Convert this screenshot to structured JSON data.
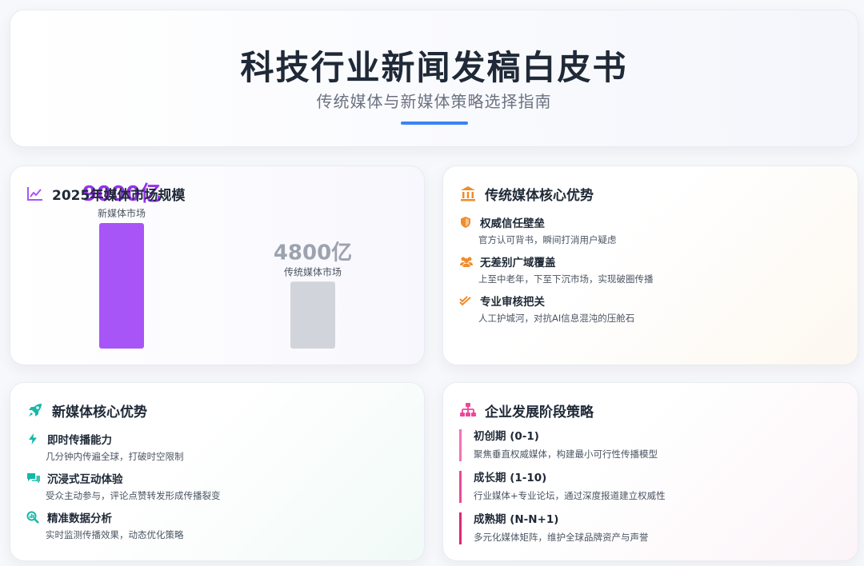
{
  "header": {
    "title": "科技行业新闻发稿白皮书",
    "subtitle": "传统媒体与新媒体策略选择指南"
  },
  "chart_section": {
    "title": "2025年媒体市场规模",
    "icon": "line-chart-icon"
  },
  "chart_data": {
    "type": "bar",
    "title": "2025年媒体市场规模",
    "categories": [
      "新媒体市场",
      "传统媒体市场"
    ],
    "values": [
      9000,
      4800
    ],
    "value_labels": [
      "9000亿",
      "4800亿"
    ],
    "unit": "亿",
    "ylim": [
      0,
      9000
    ],
    "colors": [
      "#a855f7",
      "#d1d5db"
    ],
    "value_label_colors": [
      "#9333ea",
      "#9ca3af"
    ]
  },
  "traditional": {
    "title": "传统媒体核心优势",
    "icon": "bank-icon",
    "accent": "#f08c2b",
    "items": [
      {
        "icon": "shield-icon",
        "title": "权威信任壁垒",
        "desc": "官方认可背书，瞬间打消用户疑虑"
      },
      {
        "icon": "users-icon",
        "title": "无差别广域覆盖",
        "desc": "上至中老年，下至下沉市场，实现破圈传播"
      },
      {
        "icon": "check-double-icon",
        "title": "专业审核把关",
        "desc": "人工护城河，对抗AI信息混沌的压舱石"
      }
    ]
  },
  "newmedia": {
    "title": "新媒体核心优势",
    "icon": "rocket-icon",
    "accent": "#14b8a6",
    "items": [
      {
        "icon": "bolt-icon",
        "title": "即时传播能力",
        "desc": "几分钟内传遍全球，打破时空限制"
      },
      {
        "icon": "comments-icon",
        "title": "沉浸式互动体验",
        "desc": "受众主动参与，评论点赞转发形成传播裂变"
      },
      {
        "icon": "analytics-icon",
        "title": "精准数据分析",
        "desc": "实时监测传播效果，动态优化策略"
      }
    ]
  },
  "strategy": {
    "title": "企业发展阶段策略",
    "icon": "sitemap-icon",
    "accent": "#ec4899",
    "stages": [
      {
        "title": "初创期 (0-1)",
        "desc": "聚焦垂直权威媒体，构建最小可行性传播模型",
        "color": "#f472b6"
      },
      {
        "title": "成长期 (1-10)",
        "desc": "行业媒体+专业论坛，通过深度报道建立权威性",
        "color": "#ec4899"
      },
      {
        "title": "成熟期 (N-N+1)",
        "desc": "多元化媒体矩阵，维护全球品牌资产与声誉",
        "color": "#db2777"
      }
    ]
  }
}
